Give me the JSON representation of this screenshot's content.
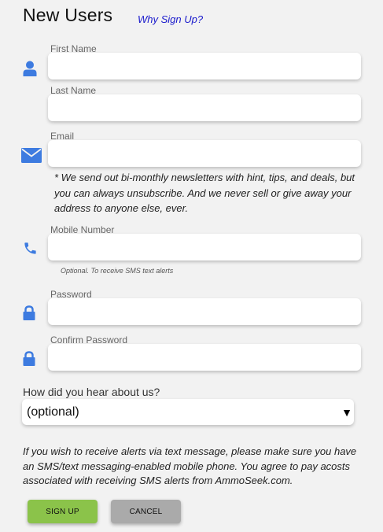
{
  "header": {
    "title": "New Users",
    "why_link": "Why Sign Up?"
  },
  "fields": {
    "first_name": {
      "label": "First Name",
      "value": "",
      "icon": "user-icon"
    },
    "last_name": {
      "label": "Last Name",
      "value": ""
    },
    "email": {
      "label": "Email",
      "value": "",
      "icon": "envelope-icon",
      "note_lines": [
        "* We send out bi-monthly newsletters with hint, tips, and deals, but",
        "you can always unsubscribe. And we never sell or give away your",
        "address to anyone else, ever."
      ]
    },
    "mobile": {
      "label": "Mobile Number",
      "value": "",
      "icon": "phone-icon",
      "note": "Optional. To receive SMS text alerts"
    },
    "password": {
      "label": "Password",
      "value": "",
      "icon": "lock-icon"
    },
    "confirm_password": {
      "label": "Confirm Password",
      "value": "",
      "icon": "lock-icon"
    }
  },
  "referral": {
    "question": "How did you hear about us?",
    "selected": "(optional)",
    "arrow": "▼"
  },
  "disclaimer_lines": [
    "If you wish to receive alerts via text message, please make sure you have",
    "an SMS/text messaging-enabled mobile phone. You agree to pay acosts",
    "associated with receiving SMS alerts from AmmoSeek.com."
  ],
  "buttons": {
    "signup": "SIGN UP",
    "cancel": "CANCEL"
  },
  "colors": {
    "icon_blue": "#3d7be0",
    "signup_green": "#8bc34a",
    "cancel_gray": "#aaaaaa",
    "link_blue": "#1a1acc"
  }
}
